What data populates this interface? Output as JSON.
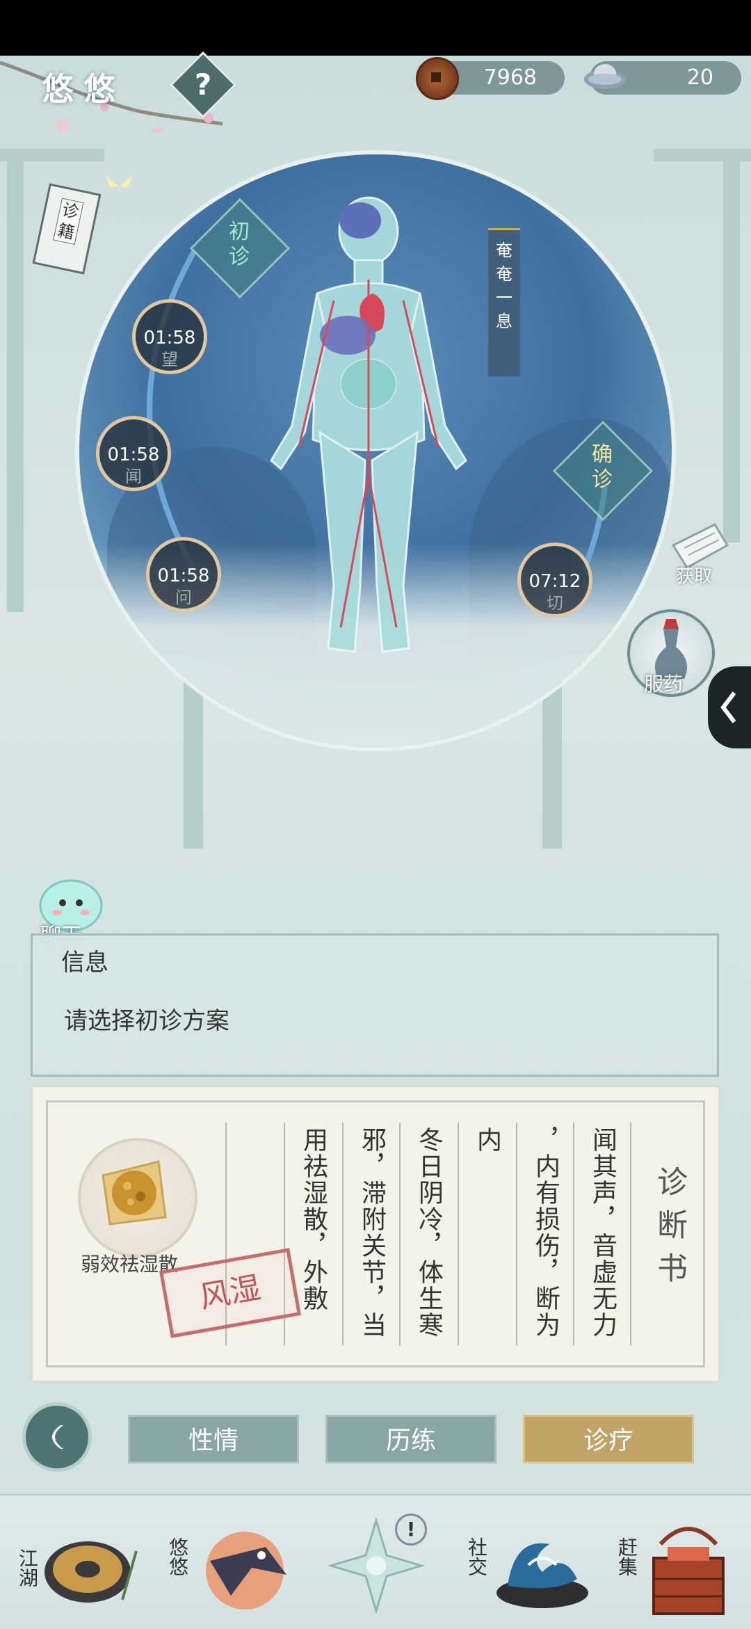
{
  "player": {
    "name": "悠悠",
    "help_label": "?"
  },
  "currency": {
    "copper_coins": "7968",
    "silver_ingots": "20"
  },
  "diagnosis_steps": {
    "initial_label": "初诊",
    "confirm_label": "确诊",
    "look_timer": "01:58",
    "look_label": "望",
    "listen_timer": "01:58",
    "listen_label": "闻",
    "ask_timer": "01:58",
    "ask_label": "问",
    "pulse_timer": "07:12",
    "pulse_label": "切"
  },
  "breath_banner": "奄奄一息",
  "side_buttons": {
    "medicine_book": "诊籍",
    "obtain": "获取",
    "take_medicine": "服药"
  },
  "chat": {
    "label": "聊天"
  },
  "info_panel": {
    "title": "信息",
    "message": "请选择初诊方案"
  },
  "diagnosis": {
    "heading": "诊断书",
    "columns": [
      "闻其声，音虚无力",
      "，内有损伤，断为",
      "内",
      "冬日阴冷，体生寒",
      "邪，滞附关节，当",
      "用祛湿散，外敷"
    ],
    "remedy_name": "弱效祛湿散",
    "stamp": "风湿"
  },
  "tabs": [
    {
      "label": "性情",
      "active": false
    },
    {
      "label": "历练",
      "active": false
    },
    {
      "label": "诊疗",
      "active": true
    }
  ],
  "bottom_nav": [
    {
      "label": "江湖",
      "icon": "umbrella-hat-icon"
    },
    {
      "label": "悠悠",
      "icon": "bird-portrait-icon"
    },
    {
      "label": "",
      "icon": "compass-star-icon",
      "badge": "!"
    },
    {
      "label": "社交",
      "icon": "wave-icon"
    },
    {
      "label": "赶集",
      "icon": "market-basket-icon"
    }
  ],
  "colors": {
    "active_tab": "#c1a465",
    "tab": "#8aa6a4",
    "stamp": "#c25656"
  }
}
